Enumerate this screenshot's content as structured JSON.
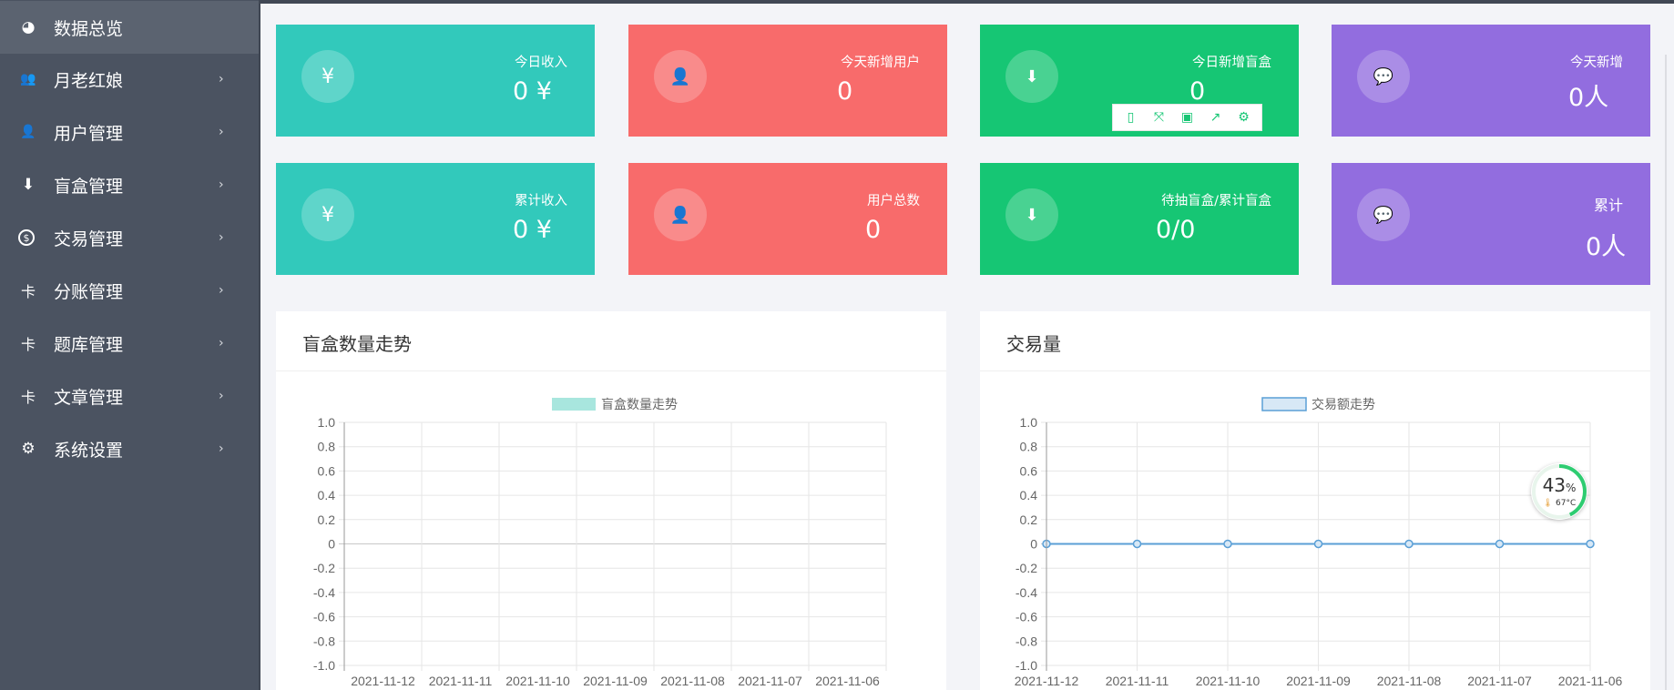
{
  "sidebar": {
    "items": [
      {
        "label": "数据总览",
        "icon": "pie-chart-icon",
        "glyph": "◕",
        "active": true
      },
      {
        "label": "月老红娘",
        "icon": "people-icon",
        "glyph": "👥",
        "active": false
      },
      {
        "label": "用户管理",
        "icon": "user-icon",
        "glyph": "👤",
        "active": false
      },
      {
        "label": "盲盒管理",
        "icon": "box-download-icon",
        "glyph": "⬇",
        "active": false
      },
      {
        "label": "交易管理",
        "icon": "coin-icon",
        "glyph": "$",
        "active": false
      },
      {
        "label": "分账管理",
        "icon": "split-icon",
        "glyph": "卡",
        "active": false
      },
      {
        "label": "题库管理",
        "icon": "split-icon",
        "glyph": "卡",
        "active": false
      },
      {
        "label": "文章管理",
        "icon": "split-icon",
        "glyph": "卡",
        "active": false
      },
      {
        "label": "系统设置",
        "icon": "gear-icon",
        "glyph": "⚙",
        "active": false
      }
    ],
    "arrow": "›"
  },
  "cards": [
    {
      "label": "今日收入",
      "value": "0 ¥",
      "icon": "yen-icon",
      "glyph": "¥",
      "color": "#32c9bb"
    },
    {
      "label": "今天新增用户",
      "value": "0",
      "icon": "user-icon",
      "glyph": "👤",
      "color": "#f86b6b"
    },
    {
      "label": "今日新增盲盒",
      "value": "0",
      "icon": "download-icon",
      "glyph": "⬇",
      "color": "#16c674"
    },
    {
      "label": "今天新增",
      "value": "0人",
      "icon": "comment-icon",
      "glyph": "💬",
      "color": "#926ddf"
    },
    {
      "label": "累计收入",
      "value": "0 ¥",
      "icon": "yen-icon",
      "glyph": "¥",
      "color": "#32c9bb"
    },
    {
      "label": "用户总数",
      "value": "0",
      "icon": "user-icon",
      "glyph": "👤",
      "color": "#f86b6b"
    },
    {
      "label": "待抽盲盒/累计盲盒",
      "value": "0/0",
      "icon": "download-icon",
      "glyph": "⬇",
      "color": "#16c674"
    },
    {
      "label": "累计",
      "value": "0人",
      "icon": "comment-icon",
      "glyph": "💬",
      "color": "#926ddf"
    }
  ],
  "toolbox": [
    {
      "icon": "data-view-icon",
      "glyph": "▯"
    },
    {
      "icon": "restore-icon",
      "glyph": "⤧"
    },
    {
      "icon": "save-icon",
      "glyph": "▣"
    },
    {
      "icon": "share-icon",
      "glyph": "↗"
    },
    {
      "icon": "settings-icon",
      "glyph": "⚙"
    }
  ],
  "panels": {
    "left": {
      "title": "盲盒数量走势"
    },
    "right": {
      "title": "交易量"
    }
  },
  "temperature": {
    "percent": "43",
    "percent_unit": "%",
    "temp": "67°C",
    "icon": "thermometer-icon",
    "level": 0.43
  },
  "chart_data": [
    {
      "type": "bar",
      "title": "",
      "legend": "盲盒数量走势",
      "legend_position": "top-center",
      "categories": [
        "2021-11-12",
        "2021-11-11",
        "2021-11-10",
        "2021-11-09",
        "2021-11-08",
        "2021-11-07",
        "2021-11-06"
      ],
      "series": [
        {
          "name": "盲盒数量走势",
          "values": [
            0,
            0,
            0,
            0,
            0,
            0,
            0
          ],
          "color": "#a8e6de"
        }
      ],
      "yticks": [
        "1.0",
        "0.8",
        "0.6",
        "0.4",
        "0.2",
        "0",
        "-0.2",
        "-0.4",
        "-0.6",
        "-0.8",
        "-1.0"
      ],
      "ylim": [
        -1.0,
        1.0
      ],
      "grid": true
    },
    {
      "type": "line",
      "title": "",
      "legend": "交易额走势",
      "legend_position": "top-center",
      "categories": [
        "2021-11-12",
        "2021-11-11",
        "2021-11-10",
        "2021-11-09",
        "2021-11-08",
        "2021-11-07",
        "2021-11-06"
      ],
      "series": [
        {
          "name": "交易额走势",
          "values": [
            0,
            0,
            0,
            0,
            0,
            0,
            0
          ],
          "color": "#5a9fd6"
        }
      ],
      "yticks": [
        "1.0",
        "0.8",
        "0.6",
        "0.4",
        "0.2",
        "0",
        "-0.2",
        "-0.4",
        "-0.6",
        "-0.8",
        "-1.0"
      ],
      "ylim": [
        -1.0,
        1.0
      ],
      "grid": true
    }
  ]
}
